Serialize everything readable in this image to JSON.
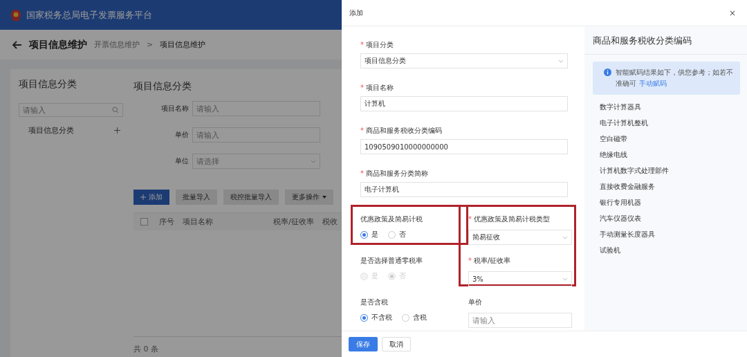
{
  "app": {
    "title": "国家税务总局电子发票服务平台"
  },
  "page": {
    "title": "项目信息维护",
    "separator": ">",
    "breadcrumb": [
      {
        "label": "开票信息维护",
        "current": false
      },
      {
        "label": "项目信息维护",
        "current": true
      }
    ]
  },
  "sidebar": {
    "title": "项目信息分类",
    "search": {
      "placeholder": "请输入"
    },
    "tree": [
      {
        "label": "项目信息分类"
      }
    ]
  },
  "content": {
    "title": "项目信息分类",
    "filters": [
      {
        "label": "项目名称",
        "kind": "input",
        "placeholder": "请输入"
      },
      {
        "label": "单价",
        "kind": "input",
        "placeholder": "请输入"
      },
      {
        "label": "单位",
        "kind": "select",
        "placeholder": "请选择"
      }
    ],
    "toolbar": [
      {
        "label": "添加",
        "kind": "primary"
      },
      {
        "label": "批量导入",
        "kind": "default"
      },
      {
        "label": "税控批量导入",
        "kind": "default"
      },
      {
        "label": "更多操作",
        "kind": "dropdown"
      }
    ],
    "table": {
      "columns": [
        {
          "kind": "checkbox",
          "checked": false
        },
        {
          "kind": "text",
          "label": "序号"
        },
        {
          "kind": "text",
          "label": "项目名称"
        },
        {
          "kind": "text",
          "label": "税率/征收率"
        },
        {
          "kind": "text",
          "label": "税收"
        }
      ]
    },
    "total": "共 0 条"
  },
  "drawer": {
    "title": "添加",
    "close": "×",
    "fields": [
      {
        "label": "项目分类",
        "marker": "*",
        "kind": "select",
        "value": "项目信息分类"
      },
      {
        "label": "项目名称",
        "marker": "*",
        "kind": "input",
        "value": "计算机"
      },
      {
        "label": "商品和服务税收分类编码",
        "marker": "*",
        "kind": "input",
        "value": "1090509010000000000"
      },
      {
        "label": "商品和服务分类简称",
        "marker": "*",
        "kind": "input",
        "value": "电子计算机"
      }
    ],
    "left_column": [
      {
        "label": "优惠政策及简易计税",
        "kind": "radio",
        "highlighted": true,
        "disabled": false,
        "options": [
          {
            "label": "是",
            "selected": true
          },
          {
            "label": "否",
            "selected": false
          }
        ]
      },
      {
        "label": "是否选择普通零税率",
        "kind": "radio",
        "highlighted": false,
        "disabled": true,
        "options": [
          {
            "label": "是",
            "selected": false
          },
          {
            "label": "否",
            "selected": true
          }
        ]
      },
      {
        "label": "是否含税",
        "kind": "radio",
        "highlighted": false,
        "disabled": false,
        "options": [
          {
            "label": "不含税",
            "selected": true
          },
          {
            "label": "含税",
            "selected": false
          }
        ]
      }
    ],
    "right_column": [
      {
        "label": "优惠政策及简易计税类型",
        "marker": "*",
        "kind": "select",
        "highlighted": true,
        "value": "简易征收"
      },
      {
        "label": "税率/征收率",
        "marker": "*",
        "kind": "select",
        "highlighted": true,
        "value": "3%"
      },
      {
        "label": "单价",
        "kind": "input",
        "highlighted": false,
        "placeholder": "请输入"
      }
    ],
    "buttons": [
      {
        "label": "保存",
        "kind": "primary"
      },
      {
        "label": "取消",
        "kind": "default"
      }
    ],
    "panel": {
      "title": "商品和服务税收分类编码",
      "notice": {
        "text": "智能赋码结果如下，供您参考；如若不准确可",
        "link": "手动赋码"
      },
      "items": [
        {
          "label": "数字计算器具"
        },
        {
          "label": "电子计算机整机"
        },
        {
          "label": "空白磁带"
        },
        {
          "label": "绝缘电线"
        },
        {
          "label": "计算机数字式处理部件"
        },
        {
          "label": "直接收费金融服务"
        },
        {
          "label": "银行专用机器"
        },
        {
          "label": "汽车仪器仪表"
        },
        {
          "label": "手动测量长度器具"
        },
        {
          "label": "试验机"
        }
      ]
    }
  }
}
